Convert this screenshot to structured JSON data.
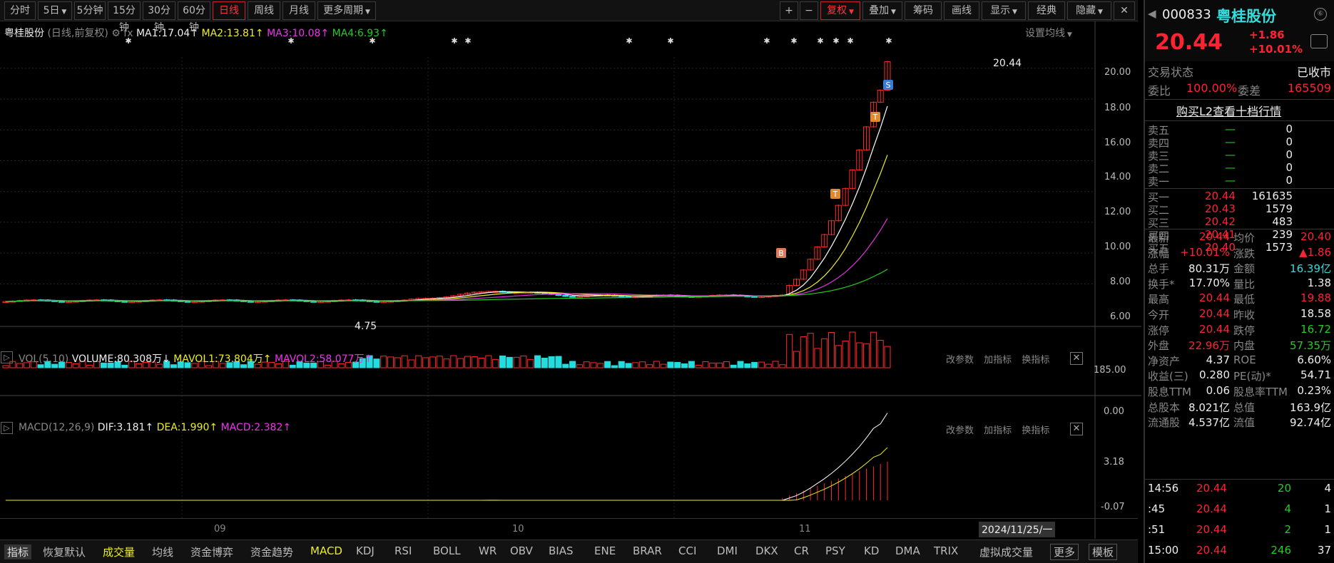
{
  "toolbar": {
    "tabs": [
      "分时",
      "5日",
      "5分钟",
      "15分钟",
      "30分钟",
      "60分钟",
      "日线",
      "周线",
      "月线",
      "更多周期"
    ],
    "active": "日线",
    "right": [
      "+",
      "−",
      "复权",
      "叠加",
      "筹码",
      "画线",
      "显示",
      "经典",
      "隐藏"
    ]
  },
  "chart_header": {
    "name": "粤桂股份",
    "mode": "(日线,前复权)",
    "fx": "fx",
    "ma1": "MA1:17.04",
    "ma2": "MA2:13.81",
    "ma3": "MA3:10.08",
    "ma4": "MA4:6.93",
    "settings": "设置均线"
  },
  "price_axis": [
    "20.00",
    "18.00",
    "16.00",
    "14.00",
    "12.00",
    "10.00",
    "8.00",
    "6.00"
  ],
  "price_labels": {
    "last": "20.44",
    "low": "4.75"
  },
  "markers": {
    "buy": "B",
    "sell": "S",
    "t": "T"
  },
  "vol_header": {
    "label": "VOL(5,10)",
    "volume": "VOLUME:80.308万",
    "mavol1": "MAVOL1:73.804万",
    "mavol2": "MAVOL2:58.077万",
    "actions": [
      "改参数",
      "加指标",
      "换指标"
    ]
  },
  "vol_axis": [
    "185.00",
    "0.00"
  ],
  "macd_header": {
    "label": "MACD(12,26,9)",
    "dif": "DIF:3.181",
    "dea": "DEA:1.990",
    "macd": "MACD:2.382",
    "actions": [
      "改参数",
      "加指标",
      "换指标"
    ]
  },
  "macd_axis": [
    "3.18",
    "-0.07"
  ],
  "date_axis": {
    "m09": "09",
    "m10": "10",
    "m11": "11",
    "cursor": "2024/11/25/一"
  },
  "bottom_tabs": [
    "指标",
    "恢复默认",
    "成交量",
    "均线",
    "资金博弈",
    "资金趋势",
    "MACD",
    "KDJ",
    "RSI",
    "BOLL",
    "WR",
    "OBV",
    "BIAS",
    "ENE",
    "BRAR",
    "CCI",
    "DMI",
    "DKX",
    "CR",
    "PSY",
    "KD",
    "DMA",
    "TRIX",
    "虚拟成交量",
    "更多",
    "模板"
  ],
  "quote": {
    "code": "000833",
    "name": "粤桂股份",
    "price": "20.44",
    "chg": "+1.86",
    "pct": "+10.01%",
    "status_label": "交易状态",
    "status": "已收市",
    "wb_label": "委比",
    "wb": "100.00%",
    "wc_label": "委差",
    "wc": "165509",
    "l2": "购买L2查看十档行情",
    "asks": [
      {
        "l": "卖五",
        "p": "—",
        "v": "0"
      },
      {
        "l": "卖四",
        "p": "—",
        "v": "0"
      },
      {
        "l": "卖三",
        "p": "—",
        "v": "0"
      },
      {
        "l": "卖二",
        "p": "—",
        "v": "0"
      },
      {
        "l": "卖一",
        "p": "—",
        "v": "0"
      }
    ],
    "bids": [
      {
        "l": "买一",
        "p": "20.44",
        "v": "161635"
      },
      {
        "l": "买二",
        "p": "20.43",
        "v": "1579"
      },
      {
        "l": "买三",
        "p": "20.42",
        "v": "483"
      },
      {
        "l": "买四",
        "p": "20.41",
        "v": "239"
      },
      {
        "l": "买五",
        "p": "20.40",
        "v": "1573"
      }
    ],
    "stats": [
      [
        "最新",
        "20.44",
        "均价",
        "20.40"
      ],
      [
        "涨幅",
        "+10.01%",
        "涨跌",
        "▲1.86"
      ],
      [
        "总手",
        "80.31万",
        "金额",
        "16.39亿"
      ],
      [
        "换手*",
        "17.70%",
        "量比",
        "1.38"
      ],
      [
        "最高",
        "20.44",
        "最低",
        "19.88"
      ],
      [
        "今开",
        "20.44",
        "昨收",
        "18.58"
      ],
      [
        "涨停",
        "20.44",
        "跌停",
        "16.72"
      ],
      [
        "外盘",
        "22.96万",
        "内盘",
        "57.35万"
      ],
      [
        "净资产",
        "4.37",
        "ROE",
        "6.60%"
      ],
      [
        "收益(三)",
        "0.280",
        "PE(动)*",
        "54.71"
      ],
      [
        "股息TTM",
        "0.06",
        "股息率TTM",
        "0.23%"
      ],
      [
        "总股本",
        "8.021亿",
        "总值",
        "163.9亿"
      ],
      [
        "流通股",
        "4.537亿",
        "流值",
        "92.74亿"
      ]
    ],
    "ticks": [
      {
        "t": "14:56",
        "p": "20.44",
        "v": "20",
        "n": "4"
      },
      {
        "t": ":45",
        "p": "20.44",
        "v": "4",
        "n": "1"
      },
      {
        "t": ":51",
        "p": "20.44",
        "v": "2",
        "n": "1"
      },
      {
        "t": "15:00",
        "p": "20.44",
        "v": "246",
        "n": "37"
      }
    ]
  },
  "colors": {
    "up": "#ff2a2a",
    "down": "#22dddd",
    "ma1": "#ffffff",
    "ma2": "#eeee22",
    "ma3": "#dd33dd",
    "ma4": "#22cc22"
  }
}
